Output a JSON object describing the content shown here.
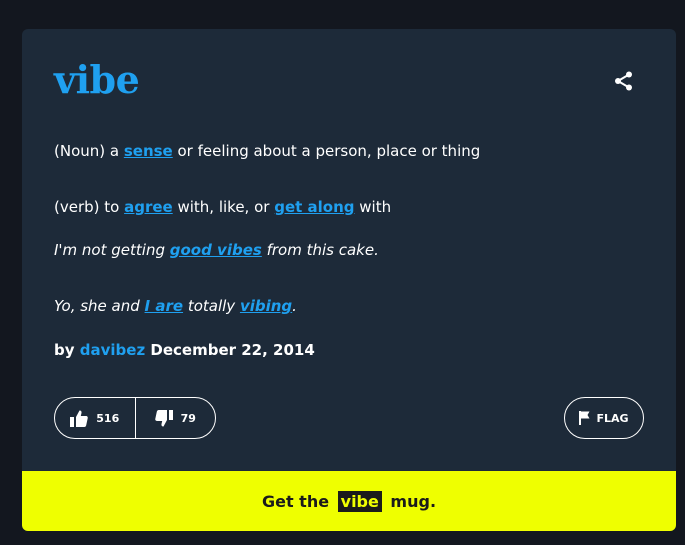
{
  "entry": {
    "word": "vibe",
    "definition": {
      "noun_prefix": "(Noun) a ",
      "noun_link": "sense",
      "noun_suffix": " or feeling about a person, place or thing",
      "verb_prefix": "(verb) to ",
      "verb_link1": "agree",
      "verb_mid": " with, like, or ",
      "verb_link2": "get along",
      "verb_suffix": " with"
    },
    "examples": {
      "ex1_prefix": "I'm not getting ",
      "ex1_link": "good vibes",
      "ex1_suffix": " from this cake.",
      "ex2_prefix": "Yo, she and ",
      "ex2_link1": "I are",
      "ex2_mid": " totally ",
      "ex2_link2": "vibing",
      "ex2_suffix": "."
    },
    "byline": {
      "by": "by ",
      "author": "davibez",
      "date": " December 22, 2014"
    }
  },
  "votes": {
    "up_count": "516",
    "down_count": "79",
    "up_icon": "thumbs-up-icon",
    "down_icon": "thumbs-down-icon"
  },
  "flag": {
    "label": "FLAG",
    "icon": "flag-icon"
  },
  "share": {
    "icon": "share-icon"
  },
  "mug_banner": {
    "prefix": "Get the ",
    "word": "vibe",
    "suffix": " mug."
  },
  "colors": {
    "background": "#13171f",
    "card": "#1d2a39",
    "accent": "#1fa0f0",
    "banner": "#efff00"
  }
}
